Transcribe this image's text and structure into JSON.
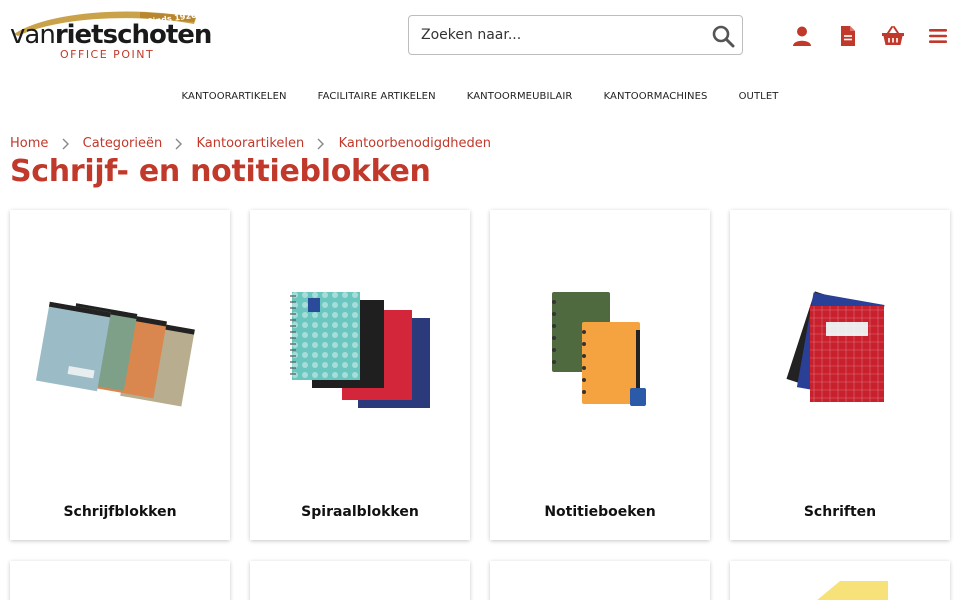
{
  "brand": {
    "name_light": "van",
    "name_bold": "rietschoten",
    "since": "Sinds 1920",
    "subline": "OFFICE POINT",
    "accent": "#c0392b"
  },
  "search": {
    "placeholder": "Zoeken naar..."
  },
  "header_icons": [
    "user-icon",
    "document-icon",
    "basket-icon",
    "menu-icon"
  ],
  "nav": {
    "items": [
      {
        "label": "KANTOORARTIKELEN"
      },
      {
        "label": "FACILITAIRE ARTIKELEN"
      },
      {
        "label": "KANTOORMEUBILAIR"
      },
      {
        "label": "KANTOORMACHINES"
      },
      {
        "label": "OUTLET"
      }
    ]
  },
  "breadcrumb": [
    {
      "label": "Home"
    },
    {
      "label": "Categorieën"
    },
    {
      "label": "Kantoorartikelen"
    },
    {
      "label": "Kantoorbenodigdheden"
    }
  ],
  "page": {
    "title": "Schrijf- en notitieblokken"
  },
  "categories": [
    {
      "label": "Schrijfblokken"
    },
    {
      "label": "Spiraalblokken"
    },
    {
      "label": "Notitieboeken"
    },
    {
      "label": "Schriften"
    }
  ]
}
